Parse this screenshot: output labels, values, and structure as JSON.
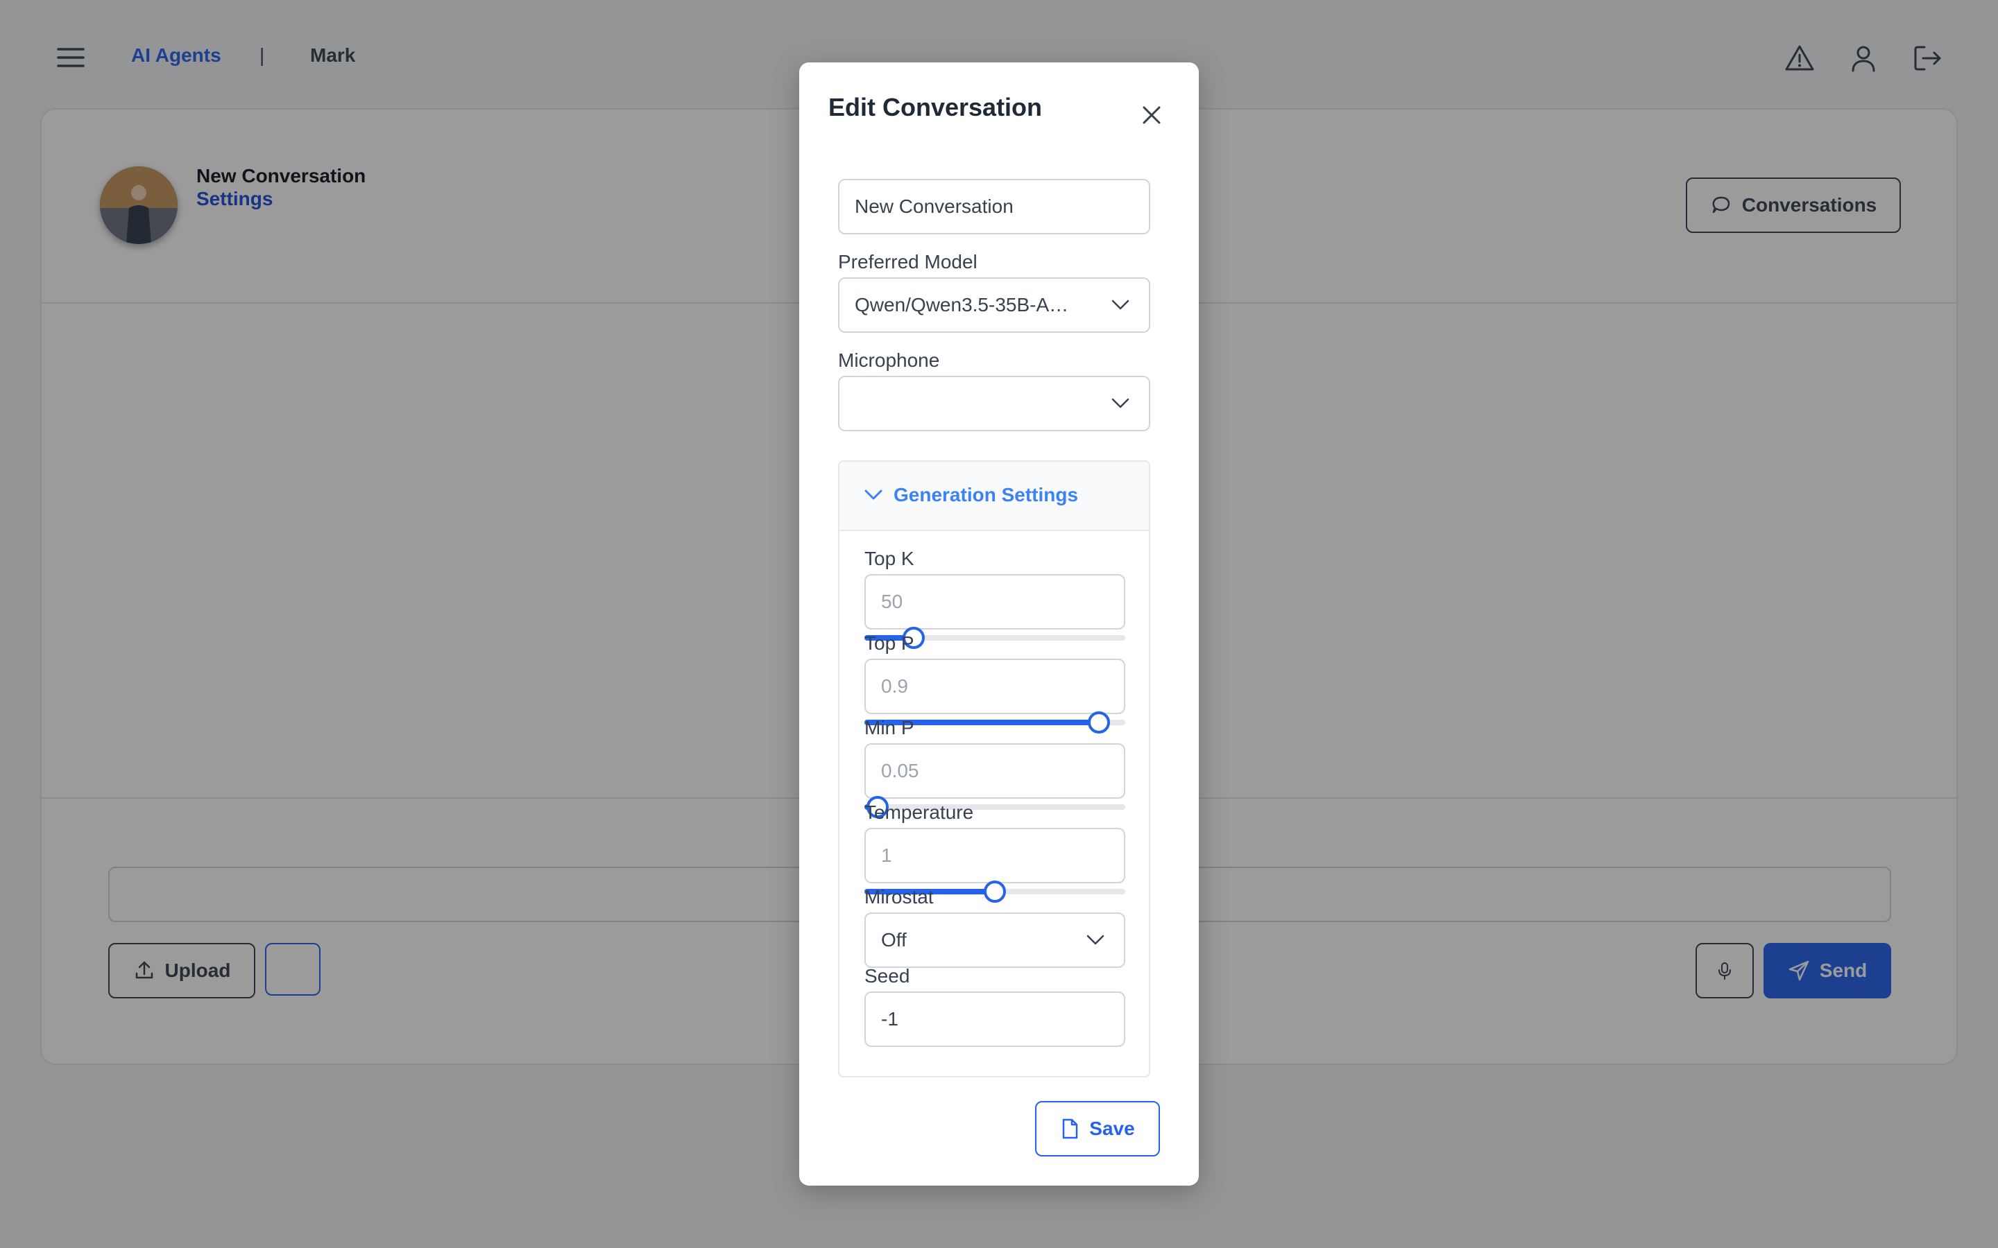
{
  "header": {
    "brand": "AI Agents",
    "separator": "|",
    "agent_name": "Mark",
    "icons": [
      "menu-icon",
      "warning-icon",
      "user-icon",
      "logout-icon"
    ]
  },
  "conversation": {
    "title": "New Conversation",
    "settings_link": "Settings",
    "conversations_button": "Conversations",
    "message_placeholder": "",
    "upload_button": "Upload",
    "send_button": "Send"
  },
  "modal": {
    "title": "Edit Conversation",
    "name_value": "New Conversation",
    "preferred_model_label": "Preferred Model",
    "preferred_model_value": "Qwen/Qwen3.5-35B-A…",
    "microphone_label": "Microphone",
    "microphone_value": "",
    "generation_settings": {
      "title": "Generation Settings",
      "top_k": {
        "label": "Top K",
        "value": "50",
        "slider_fraction": 0.19
      },
      "top_p": {
        "label": "Top P",
        "value": "0.9",
        "slider_fraction": 0.9
      },
      "min_p": {
        "label": "Min P",
        "value": "0.05",
        "slider_fraction": 0.05
      },
      "temperature": {
        "label": "Temperature",
        "value": "1",
        "slider_fraction": 0.5
      },
      "mirostat": {
        "label": "Mirostat",
        "value": "Off"
      },
      "seed": {
        "label": "Seed",
        "value": "-1"
      }
    },
    "save_button": "Save"
  },
  "colors": {
    "accent": "#2563eb",
    "overlay": "rgba(17,17,17,0.42)"
  }
}
